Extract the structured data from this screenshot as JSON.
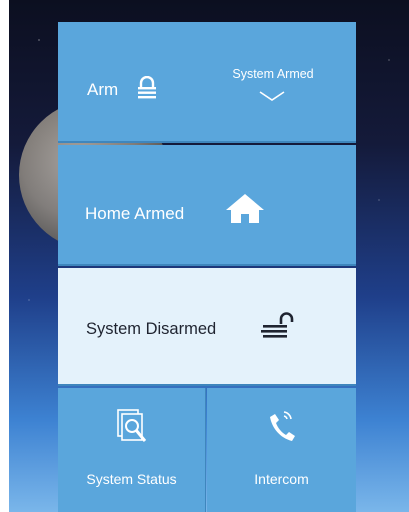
{
  "arm_tile": {
    "label": "Arm",
    "status": "System Armed",
    "icon": "lock-closed-icon",
    "dropdown_icon": "chevron-down-icon"
  },
  "home_tile": {
    "label": "Home Armed",
    "icon": "house-icon"
  },
  "disarmed_tile": {
    "label": "System Disarmed",
    "icon": "lock-open-icon"
  },
  "bottom_tiles": [
    {
      "label": "System Status",
      "icon": "document-search-icon"
    },
    {
      "label": "Intercom",
      "icon": "phone-icon"
    }
  ],
  "colors": {
    "tile_blue": "#5aa6dc",
    "tile_selected": "#e4f2fb",
    "divider": "#3e86bd"
  }
}
